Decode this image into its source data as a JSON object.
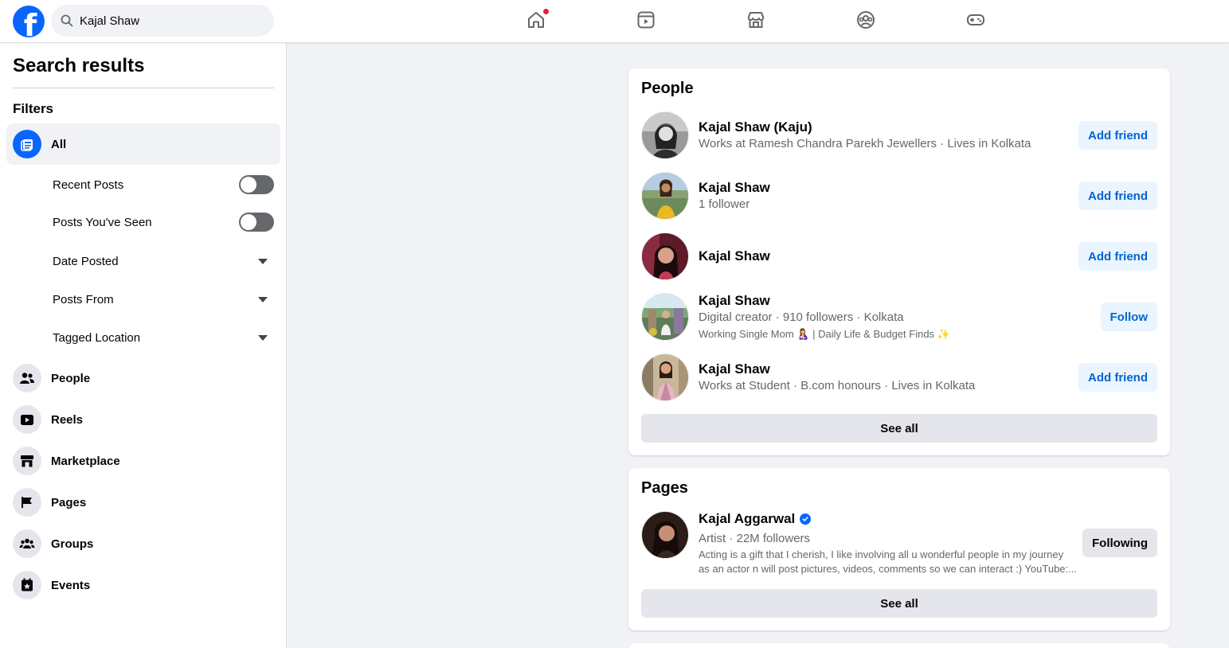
{
  "search": {
    "value": "Kajal Shaw"
  },
  "nav": {
    "icons": [
      "home-icon",
      "video-icon",
      "marketplace-icon",
      "groups-icon",
      "gaming-icon"
    ],
    "notification_color": "#e41e3f"
  },
  "sidebar": {
    "title": "Search results",
    "filters_label": "Filters",
    "all_label": "All",
    "sub_filters": [
      {
        "label": "Recent Posts",
        "control": "toggle",
        "on": false
      },
      {
        "label": "Posts You've Seen",
        "control": "toggle",
        "on": false
      },
      {
        "label": "Date Posted",
        "control": "dropdown"
      },
      {
        "label": "Posts From",
        "control": "dropdown"
      },
      {
        "label": "Tagged Location",
        "control": "dropdown"
      }
    ],
    "categories": [
      {
        "label": "People",
        "icon": "people-icon"
      },
      {
        "label": "Reels",
        "icon": "reels-icon"
      },
      {
        "label": "Marketplace",
        "icon": "marketplace-icon"
      },
      {
        "label": "Pages",
        "icon": "flag-icon"
      },
      {
        "label": "Groups",
        "icon": "groups-icon"
      },
      {
        "label": "Events",
        "icon": "calendar-star-icon"
      }
    ]
  },
  "people": {
    "title": "People",
    "results": [
      {
        "name": "Kajal Shaw (Kaju)",
        "sub": "Works at Ramesh Chandra Parekh Jewellers · Lives in Kolkata",
        "action": "Add friend"
      },
      {
        "name": "Kajal Shaw",
        "sub": "1 follower",
        "action": "Add friend"
      },
      {
        "name": "Kajal Shaw",
        "sub": "",
        "action": "Add friend"
      },
      {
        "name": "Kajal Shaw",
        "sub": "Digital creator · 910 followers · Kolkata",
        "bio": "Working Single Mom 🤱 | Daily Life & Budget Finds ✨",
        "action": "Follow"
      },
      {
        "name": "Kajal Shaw",
        "sub": "Works at Student · B.com honours · Lives in Kolkata",
        "action": "Add friend"
      }
    ],
    "see_all": "See all"
  },
  "pages": {
    "title": "Pages",
    "results": [
      {
        "name": "Kajal Aggarwal",
        "verified": true,
        "sub": "Artist · 22M followers",
        "desc_line1": "Acting is a gift that I cherish, I like involving all u wonderful people in my journey",
        "desc_line2": "as an actor n will post pictures, videos, comments so we can interact :) YouTube:...",
        "action": "Following"
      }
    ],
    "see_all": "See all"
  },
  "colors": {
    "brand": "#0866ff",
    "button_text": "#0064d1",
    "button_bg": "#ebf5ff"
  }
}
